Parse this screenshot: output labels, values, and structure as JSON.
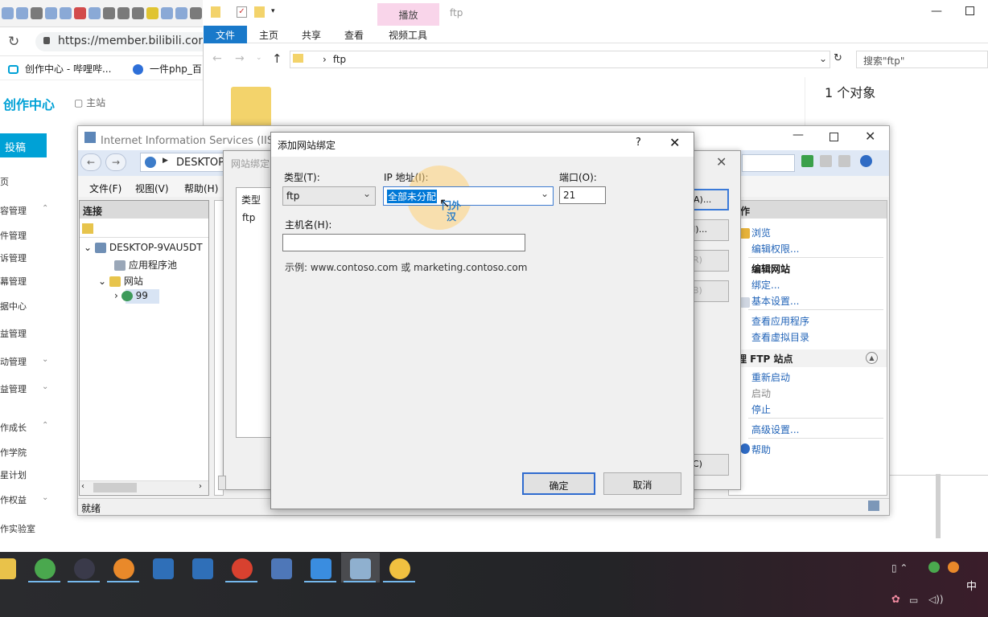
{
  "browser": {
    "url": "https://member.bilibili.com",
    "bookmarks": [
      "创作中心 - 哔哩哔...",
      "一件php_百"
    ],
    "brand": "创作中心",
    "home": "主站",
    "upload": "投稿",
    "side": [
      {
        "t": "页",
        "c": ""
      },
      {
        "t": "容管理",
        "c": "⌃"
      },
      {
        "t": "件管理",
        "c": ""
      },
      {
        "t": "诉管理",
        "c": ""
      },
      {
        "t": "幕管理",
        "c": ""
      },
      {
        "t": "据中心",
        "c": ""
      },
      {
        "t": "益管理",
        "c": ""
      },
      {
        "t": "动管理",
        "c": "⌄"
      },
      {
        "t": "益管理",
        "c": "⌄"
      },
      {
        "t": "作成长",
        "c": "⌃"
      },
      {
        "t": "作学院",
        "c": ""
      },
      {
        "t": "星计划",
        "c": ""
      },
      {
        "t": "作权益",
        "c": "⌄"
      },
      {
        "t": "作实验室",
        "c": ""
      }
    ]
  },
  "explorer": {
    "tab_highlight": "播放",
    "name": "ftp",
    "ribbon_tabs": [
      "文件",
      "主页",
      "共享",
      "查看",
      "视频工具"
    ],
    "path": "ftp",
    "search_placeholder": "搜索\"ftp\"",
    "count": "1 个对象"
  },
  "iis": {
    "title": "Internet Information Services (IIS)管",
    "path": "DESKTOP-",
    "menu": [
      "文件(F)",
      "视图(V)",
      "帮助(H)"
    ],
    "conn_head": "连接",
    "tree": [
      "DESKTOP-9VAU5DT",
      "应用程序池",
      "网站",
      "99"
    ],
    "status": "就绪",
    "actions_head": "作",
    "actions": {
      "browse": "浏览",
      "edit_perm": "编辑权限...",
      "edit_site": "编辑网站",
      "bindings": "绑定...",
      "basic": "基本设置...",
      "view_apps": "查看应用程序",
      "view_vdirs": "查看虚拟目录",
      "ftp_head": "理 FTP 站点",
      "restart": "重新启动",
      "start": "启动",
      "stop": "停止",
      "advanced": "高级设置...",
      "help": "帮助"
    }
  },
  "bindings_dialog": {
    "title": "网站绑定",
    "col_type": "类型",
    "row_type": "ftp",
    "buttons": [
      "A)...",
      "I)...",
      "R)",
      "B)",
      "C)"
    ]
  },
  "add_binding": {
    "title": "添加网站绑定",
    "help": "?",
    "type_label": "类型(T):",
    "type_value": "ftp",
    "ip_label": "IP 地址(I):",
    "ip_value": "全部未分配",
    "port_label": "端口(O):",
    "port_value": "21",
    "host_label": "主机名(H):",
    "host_value": "",
    "example": "示例: www.contoso.com 或 marketing.contoso.com",
    "ok": "确定",
    "cancel": "取消",
    "watermark": "门外汉"
  },
  "tray": {
    "ime": "中"
  },
  "colors": {
    "accent": "#00a1d6",
    "selection": "#0078d7",
    "ribbon_file": "#1979ca",
    "link": "#2264b8"
  }
}
